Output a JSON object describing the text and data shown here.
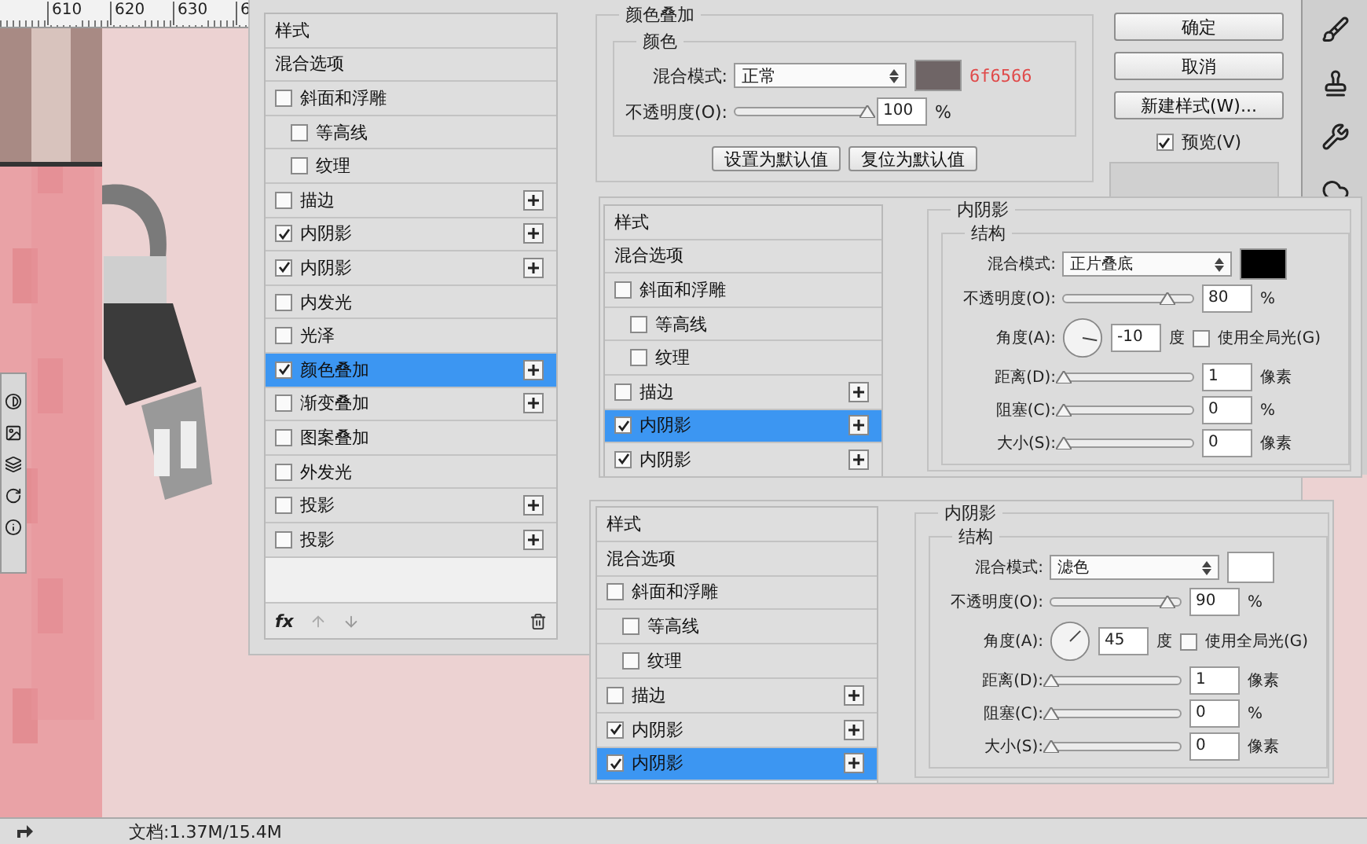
{
  "ruler": {
    "ticks": [
      "610",
      "620",
      "630",
      "6"
    ]
  },
  "style_panels": [
    {
      "items": [
        {
          "kind": "heading",
          "label": "样式",
          "selected": false
        },
        {
          "kind": "plain",
          "label": "混合选项",
          "selected": false
        },
        {
          "kind": "option",
          "label": "斜面和浮雕",
          "checked": false,
          "addable": false,
          "selected": false,
          "children": [
            {
              "kind": "option",
              "label": "等高线",
              "checked": false,
              "addable": false,
              "selected": false
            },
            {
              "kind": "option",
              "label": "纹理",
              "checked": false,
              "addable": false,
              "selected": false
            }
          ]
        },
        {
          "kind": "option",
          "label": "描边",
          "checked": false,
          "addable": true,
          "selected": false
        },
        {
          "kind": "option",
          "label": "内阴影",
          "checked": true,
          "addable": true,
          "selected": false
        },
        {
          "kind": "option",
          "label": "内阴影",
          "checked": true,
          "addable": true,
          "selected": false
        },
        {
          "kind": "option",
          "label": "内发光",
          "checked": false,
          "addable": false,
          "selected": false
        },
        {
          "kind": "option",
          "label": "光泽",
          "checked": false,
          "addable": false,
          "selected": false
        },
        {
          "kind": "option",
          "label": "颜色叠加",
          "checked": true,
          "addable": true,
          "selected": true
        },
        {
          "kind": "option",
          "label": "渐变叠加",
          "checked": false,
          "addable": true,
          "selected": false
        },
        {
          "kind": "option",
          "label": "图案叠加",
          "checked": false,
          "addable": false,
          "selected": false
        },
        {
          "kind": "option",
          "label": "外发光",
          "checked": false,
          "addable": false,
          "selected": false
        },
        {
          "kind": "option",
          "label": "投影",
          "checked": false,
          "addable": true,
          "selected": false
        },
        {
          "kind": "option",
          "label": "投影",
          "checked": false,
          "addable": true,
          "selected": false
        }
      ],
      "footer_label": "fx"
    },
    {
      "items": [
        {
          "kind": "heading",
          "label": "样式",
          "selected": false
        },
        {
          "kind": "plain",
          "label": "混合选项",
          "selected": false
        },
        {
          "kind": "option",
          "label": "斜面和浮雕",
          "checked": false,
          "addable": false,
          "selected": false,
          "children": [
            {
              "kind": "option",
              "label": "等高线",
              "checked": false,
              "addable": false,
              "selected": false
            },
            {
              "kind": "option",
              "label": "纹理",
              "checked": false,
              "addable": false,
              "selected": false
            }
          ]
        },
        {
          "kind": "option",
          "label": "描边",
          "checked": false,
          "addable": true,
          "selected": false
        },
        {
          "kind": "option",
          "label": "内阴影",
          "checked": true,
          "addable": true,
          "selected": true
        },
        {
          "kind": "option",
          "label": "内阴影",
          "checked": true,
          "addable": true,
          "selected": false
        }
      ]
    },
    {
      "items": [
        {
          "kind": "heading",
          "label": "样式",
          "selected": false
        },
        {
          "kind": "plain",
          "label": "混合选项",
          "selected": false
        },
        {
          "kind": "option",
          "label": "斜面和浮雕",
          "checked": false,
          "addable": false,
          "selected": false,
          "children": [
            {
              "kind": "option",
              "label": "等高线",
              "checked": false,
              "addable": false,
              "selected": false
            },
            {
              "kind": "option",
              "label": "纹理",
              "checked": false,
              "addable": false,
              "selected": false
            }
          ]
        },
        {
          "kind": "option",
          "label": "描边",
          "checked": false,
          "addable": true,
          "selected": false
        },
        {
          "kind": "option",
          "label": "内阴影",
          "checked": true,
          "addable": true,
          "selected": false
        },
        {
          "kind": "option",
          "label": "内阴影",
          "checked": true,
          "addable": true,
          "selected": true
        }
      ]
    }
  ],
  "color_overlay": {
    "title": "颜色叠加",
    "group": "颜色",
    "blend_label": "混合模式:",
    "blend_mode": "正常",
    "color": "#6f6566",
    "color_note": "6f6566",
    "opacity_label": "不透明度(O):",
    "opacity": {
      "level": 1.0,
      "value": "100",
      "unit": "%"
    },
    "buttons": [
      "设置为默认值",
      "复位为默认值"
    ]
  },
  "dialog_buttons": [
    "确定",
    "取消",
    "新建样式(W)..."
  ],
  "preview": {
    "label": "预览(V)",
    "checked": true
  },
  "inner_shadows": [
    {
      "title": "内阴影",
      "group": "结构",
      "blend_label": "混合模式:",
      "blend_mode": "正片叠底",
      "color": "#000000",
      "opacity_label": "不透明度(O):",
      "opacity": {
        "level": 0.8,
        "value": "80",
        "unit": "%"
      },
      "angle_label": "角度(A):",
      "angle": "-10",
      "angle_unit": "度",
      "global_light": {
        "label": "使用全局光(G)",
        "checked": false
      },
      "sliders": [
        {
          "label": "距离(D):",
          "level": 0,
          "value": "1",
          "unit": "像素"
        },
        {
          "label": "阻塞(C):",
          "level": 0,
          "value": "0",
          "unit": "%"
        },
        {
          "label": "大小(S):",
          "level": 0,
          "value": "0",
          "unit": "像素"
        }
      ]
    },
    {
      "title": "内阴影",
      "group": "结构",
      "blend_label": "混合模式:",
      "blend_mode": "滤色",
      "color": "#ffffff",
      "opacity_label": "不透明度(O):",
      "opacity": {
        "level": 0.9,
        "value": "90",
        "unit": "%"
      },
      "angle_label": "角度(A):",
      "angle": "45",
      "angle_unit": "度",
      "global_light": {
        "label": "使用全局光(G)",
        "checked": false
      },
      "sliders": [
        {
          "label": "距离(D):",
          "level": 0,
          "value": "1",
          "unit": "像素"
        },
        {
          "label": "阻塞(C):",
          "level": 0,
          "value": "0",
          "unit": "%"
        },
        {
          "label": "大小(S):",
          "level": 0,
          "value": "0",
          "unit": "像素"
        }
      ]
    }
  ],
  "status_bar": {
    "document": "文档:1.37M/15.4M"
  }
}
